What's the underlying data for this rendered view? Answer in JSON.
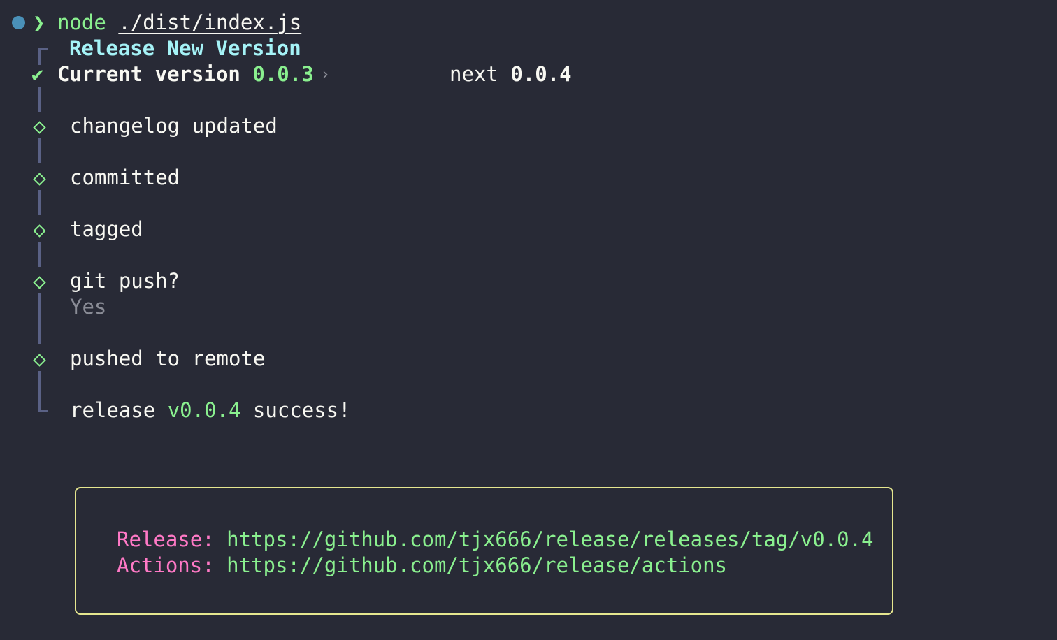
{
  "terminal": {
    "prompt": {
      "command": "node",
      "argument_prefix": "./dist/index.",
      "argument_ext": "js"
    },
    "header": {
      "title": "Release New Version",
      "current_label": "Current version",
      "current_version": "0.0.3",
      "arrow": "›",
      "next_label": "next",
      "next_version": "0.0.4"
    },
    "steps": [
      {
        "label": "changelog updated"
      },
      {
        "label": "committed"
      },
      {
        "label": "tagged"
      },
      {
        "label": "git push?",
        "answer": "Yes"
      },
      {
        "label": "pushed to remote"
      }
    ],
    "result": {
      "prefix": "release",
      "version": "v0.0.4",
      "suffix": "success!"
    },
    "links_box": {
      "release_label": "Release:",
      "release_url": "https://github.com/tjx666/release/releases/tag/v0.0.4",
      "actions_label": "Actions:",
      "actions_url": "https://github.com/tjx666/release/actions"
    }
  },
  "colors": {
    "background": "#282a36",
    "green": "#8af08f",
    "cyan": "#a5f3f7",
    "pink": "#ff79c6",
    "box_border": "#e5e68f",
    "rail": "#5a6185"
  }
}
